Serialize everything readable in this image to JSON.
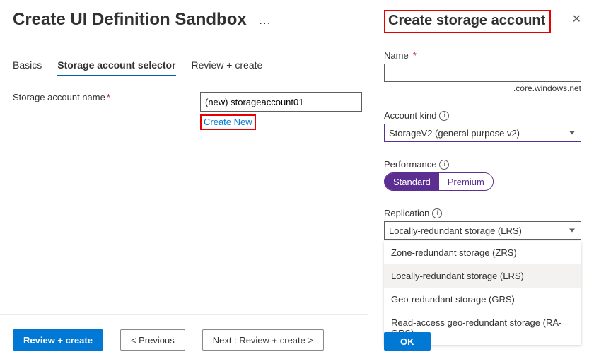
{
  "page": {
    "title": "Create UI Definition Sandbox"
  },
  "tabs": {
    "basics": "Basics",
    "selector": "Storage account selector",
    "review": "Review + create"
  },
  "form": {
    "storage_name_label": "Storage account name",
    "storage_name_value": "(new) storageaccount01",
    "create_new": "Create New"
  },
  "footer": {
    "review_create": "Review + create",
    "previous": "<  Previous",
    "next": "Next : Review + create  >"
  },
  "panel": {
    "title": "Create storage account",
    "name_label": "Name",
    "name_value": "",
    "name_suffix": ".core.windows.net",
    "account_kind_label": "Account kind",
    "account_kind_value": "StorageV2 (general purpose v2)",
    "performance_label": "Performance",
    "perf_standard": "Standard",
    "perf_premium": "Premium",
    "replication_label": "Replication",
    "replication_value": "Locally-redundant storage (LRS)",
    "replication_options": {
      "zrs": "Zone-redundant storage (ZRS)",
      "lrs": "Locally-redundant storage (LRS)",
      "grs": "Geo-redundant storage (GRS)",
      "ragrs": "Read-access geo-redundant storage (RA-GRS)"
    },
    "ok": "OK"
  }
}
